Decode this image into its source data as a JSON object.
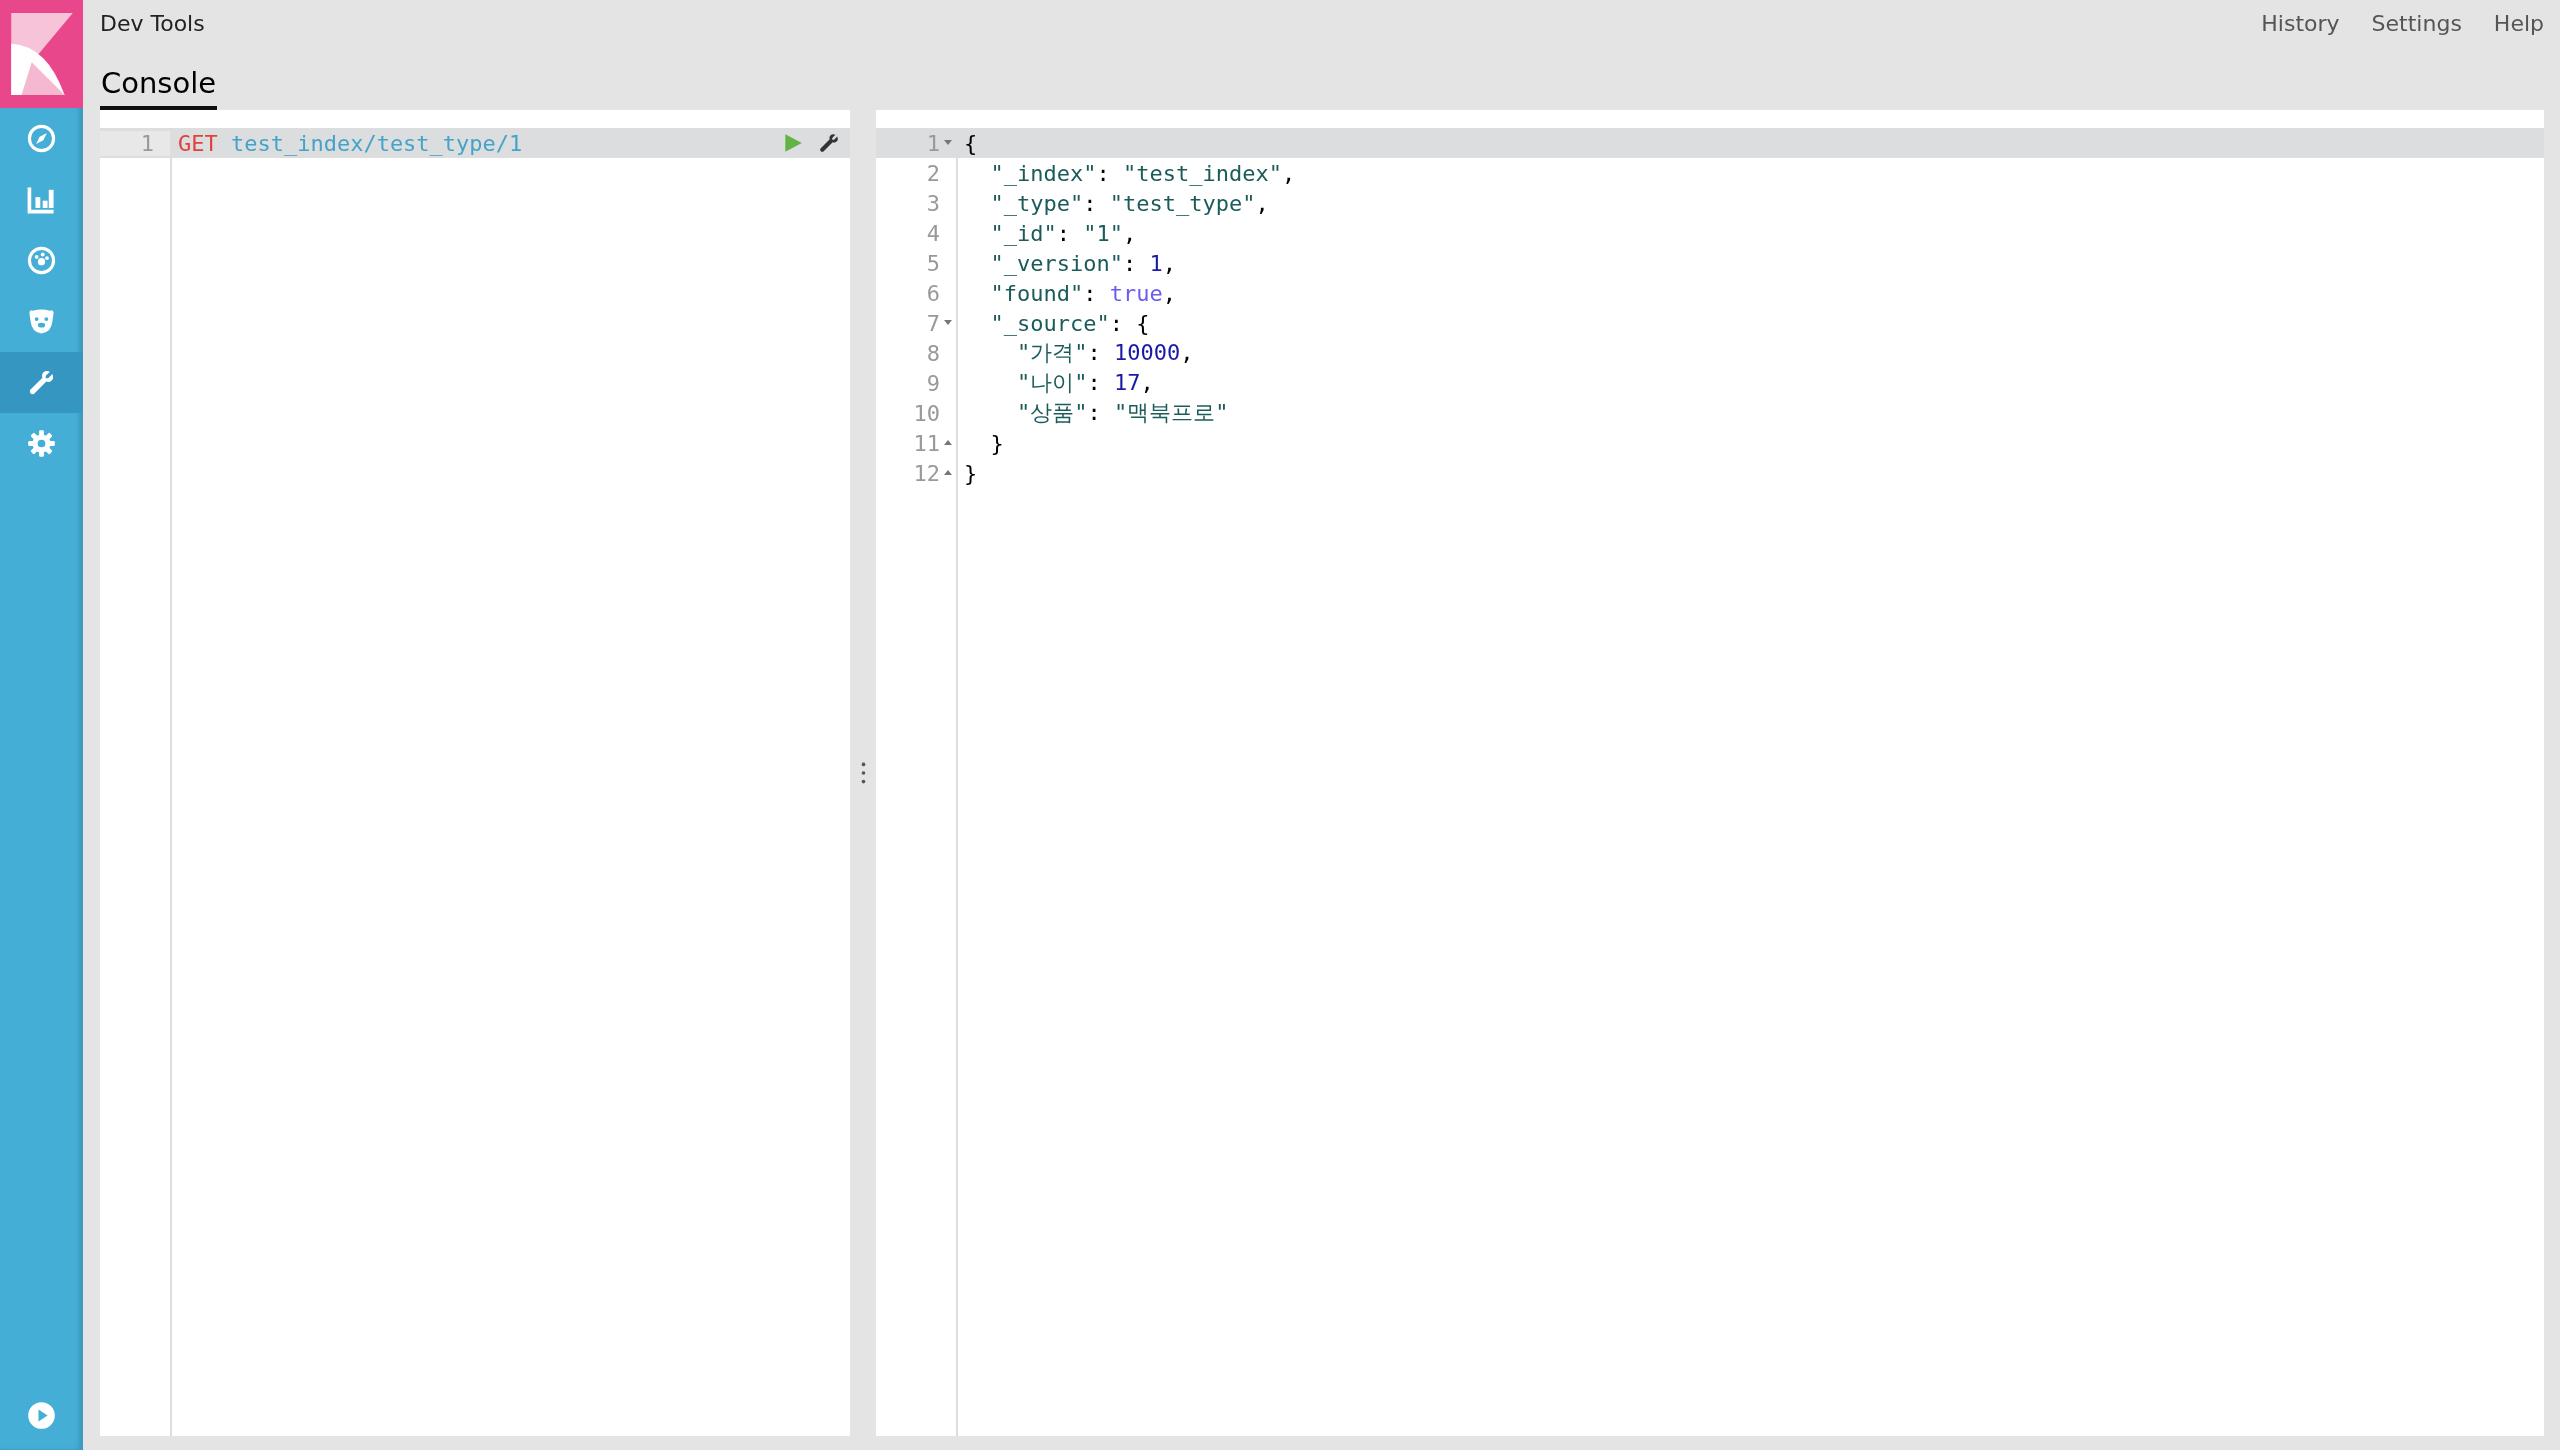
{
  "header": {
    "title": "Dev Tools",
    "menu": [
      "History",
      "Settings",
      "Help"
    ]
  },
  "tabs": [
    {
      "label": "Console",
      "selected": true
    }
  ],
  "sidebar": {
    "items": [
      {
        "kind": "compass",
        "selected": false
      },
      {
        "kind": "chart",
        "selected": false
      },
      {
        "kind": "gauge",
        "selected": false
      },
      {
        "kind": "bear",
        "selected": false
      },
      {
        "kind": "wrench",
        "selected": true
      },
      {
        "kind": "gear",
        "selected": false
      }
    ],
    "bottom": {
      "kind": "play"
    }
  },
  "request": {
    "lines": [
      {
        "number": "1",
        "selected": true,
        "tokens": [
          {
            "text": "GET",
            "kind": "method"
          },
          {
            "text": "test_index/test_type/1",
            "kind": "url"
          }
        ]
      }
    ]
  },
  "response": {
    "lines": [
      {
        "number": "1",
        "kind": "fold-start",
        "selected": true,
        "tokens": [
          {
            "text": "{",
            "kind": "punct"
          }
        ]
      },
      {
        "number": "2",
        "selected": false,
        "tokens": [
          {
            "text": "  \"_index\"",
            "kind": "key"
          },
          {
            "text": ": ",
            "kind": "punct"
          },
          {
            "text": "\"test_index\"",
            "kind": "string"
          },
          {
            "text": ",",
            "kind": "punct"
          }
        ]
      },
      {
        "number": "3",
        "selected": false,
        "tokens": [
          {
            "text": "  \"_type\"",
            "kind": "key"
          },
          {
            "text": ": ",
            "kind": "punct"
          },
          {
            "text": "\"test_type\"",
            "kind": "string"
          },
          {
            "text": ",",
            "kind": "punct"
          }
        ]
      },
      {
        "number": "4",
        "selected": false,
        "tokens": [
          {
            "text": "  \"_id\"",
            "kind": "key"
          },
          {
            "text": ": ",
            "kind": "punct"
          },
          {
            "text": "\"1\"",
            "kind": "string"
          },
          {
            "text": ",",
            "kind": "punct"
          }
        ]
      },
      {
        "number": "5",
        "selected": false,
        "tokens": [
          {
            "text": "  \"_version\"",
            "kind": "key"
          },
          {
            "text": ": ",
            "kind": "punct"
          },
          {
            "text": "1",
            "kind": "number"
          },
          {
            "text": ",",
            "kind": "punct"
          }
        ]
      },
      {
        "number": "6",
        "selected": false,
        "tokens": [
          {
            "text": "  \"found\"",
            "kind": "key"
          },
          {
            "text": ": ",
            "kind": "punct"
          },
          {
            "text": "true",
            "kind": "boolean"
          },
          {
            "text": ",",
            "kind": "punct"
          }
        ]
      },
      {
        "number": "7",
        "kind": "fold-start",
        "selected": false,
        "tokens": [
          {
            "text": "  \"_source\"",
            "kind": "key"
          },
          {
            "text": ": {",
            "kind": "punct"
          }
        ]
      },
      {
        "number": "8",
        "selected": false,
        "tokens": [
          {
            "text": "    \"가격\"",
            "kind": "key"
          },
          {
            "text": ": ",
            "kind": "punct"
          },
          {
            "text": "10000",
            "kind": "number"
          },
          {
            "text": ",",
            "kind": "punct"
          }
        ]
      },
      {
        "number": "9",
        "selected": false,
        "tokens": [
          {
            "text": "    \"나이\"",
            "kind": "key"
          },
          {
            "text": ": ",
            "kind": "punct"
          },
          {
            "text": "17",
            "kind": "number"
          },
          {
            "text": ",",
            "kind": "punct"
          }
        ]
      },
      {
        "number": "10",
        "selected": false,
        "tokens": [
          {
            "text": "    \"상품\"",
            "kind": "key"
          },
          {
            "text": ": ",
            "kind": "punct"
          },
          {
            "text": "\"맥북프로\"",
            "kind": "string"
          }
        ]
      },
      {
        "number": "11",
        "kind": "fold-end",
        "selected": false,
        "tokens": [
          {
            "text": "  }",
            "kind": "punct"
          }
        ]
      },
      {
        "number": "12",
        "kind": "fold-end",
        "selected": false,
        "tokens": [
          {
            "text": "}",
            "kind": "punct"
          }
        ]
      }
    ]
  }
}
